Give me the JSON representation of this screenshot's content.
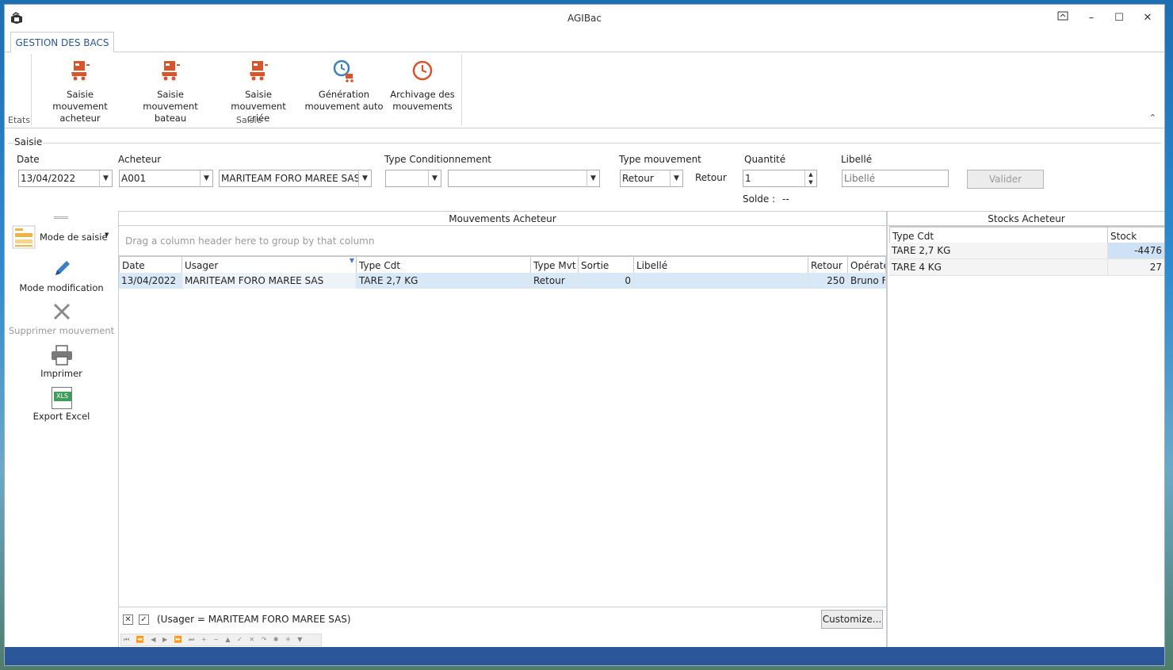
{
  "window": {
    "title": "AGIBac",
    "controls": {
      "restore_ribbon": "⊼",
      "minimize": "–",
      "maximize": "☐",
      "close": "✕"
    }
  },
  "ribbon": {
    "tab_label": "GESTION DES BACS",
    "group_etats": "Etats",
    "group_saisie": "Saisie",
    "buttons": [
      {
        "line1": "Saisie mouvement",
        "line2": "acheteur",
        "icon": "cart-icon"
      },
      {
        "line1": "Saisie mouvement",
        "line2": "bateau",
        "icon": "cart-icon"
      },
      {
        "line1": "Saisie",
        "line2": "mouvement criée",
        "icon": "cart-icon"
      },
      {
        "line1": "Génération",
        "line2": "mouvement auto",
        "icon": "clock-cart-icon"
      },
      {
        "line1": "Archivage des",
        "line2": "mouvements",
        "icon": "clock-icon"
      }
    ],
    "collapse": "⌃"
  },
  "saisie": {
    "legend": "Saisie",
    "date_label": "Date",
    "date_value": "13/04/2022",
    "acheteur_label": "Acheteur",
    "acheteur_code": "A001",
    "acheteur_name": "MARITEAM FORO MAREE SAS",
    "type_cond_label": "Type Conditionnement",
    "type_cond_code": "",
    "type_cond_name": "",
    "type_mvt_label": "Type mouvement",
    "type_mvt_value": "Retour",
    "type_mvt_text": "Retour",
    "quantite_label": "Quantité",
    "quantite_value": "1",
    "solde_label": "Solde :",
    "solde_value": "--",
    "libelle_label": "Libellé",
    "libelle_placeholder": "Libellé",
    "valider": "Valider"
  },
  "leftbar": {
    "mode_saisie": "Mode de saisie",
    "mode_modification": "Mode modification",
    "supprimer": "Supprimer mouvement",
    "imprimer": "Imprimer",
    "export_excel": "Export Excel",
    "xls_text": "XLS"
  },
  "mouvements": {
    "title": "Mouvements Acheteur",
    "group_hint": "Drag a column header here to group by that column",
    "columns": [
      "Date",
      "Usager",
      "Type Cdt",
      "Type Mvt",
      "Sortie",
      "Libellé",
      "Retour",
      "Opérate"
    ],
    "rows": [
      [
        "13/04/2022",
        "MARITEAM FORO MAREE SAS",
        "TARE 2,7 KG",
        "Retour",
        "0",
        "",
        "250",
        "Bruno F"
      ]
    ],
    "filter_text": "(Usager = MARITEAM FORO MAREE SAS)",
    "customize": "Customize...",
    "nav_icons": "⏮ ⏪ ◀ ▶ ⏩ ⏭ + − ▲ ✓ ✕ ↷ ✱ ✳ ▼"
  },
  "stocks": {
    "title": "Stocks Acheteur",
    "columns": [
      "Type Cdt",
      "Stock"
    ],
    "rows": [
      [
        "TARE 2,7 KG",
        "-4476"
      ],
      [
        "TARE 4 KG",
        "27"
      ]
    ]
  },
  "colors": {
    "accent": "#2b5797",
    "ribbon_icon": "#d9542b",
    "selected_row": "#d9e8f6",
    "taskbar": "#2b579a"
  }
}
